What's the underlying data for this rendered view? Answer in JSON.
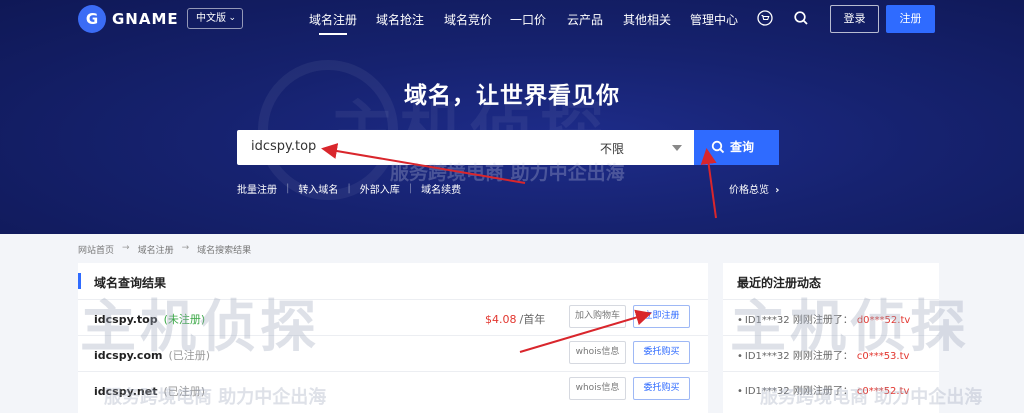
{
  "nav": {
    "logo_letter": "G",
    "logo_text": "GNAME",
    "language": "中文版",
    "items": [
      "域名注册",
      "域名抢注",
      "域名竞价",
      "一口价",
      "云产品",
      "其他相关",
      "管理中心"
    ],
    "login_label": "登录",
    "register_label": "注册"
  },
  "hero": {
    "slogan": "域名，让世界看见你",
    "search_value": "idcspy.top",
    "suffix_selected": "不限",
    "search_button": "查询",
    "quick_links": [
      "批量注册",
      "转入域名",
      "外部入库",
      "域名续费"
    ],
    "price_overview": "价格总览"
  },
  "breadcrumb": [
    "网站首页",
    "域名注册",
    "域名搜索结果"
  ],
  "results": {
    "title": "域名查询结果",
    "rows": [
      {
        "domain": "idcspy.top",
        "status": "(未注册)",
        "price": "$4.08",
        "unit": "/首年",
        "btn1": "加入购物车",
        "btn2": "立即注册"
      },
      {
        "domain": "idcspy.com",
        "status": "(已注册)",
        "btn1": "whois信息",
        "btn2": "委托购买"
      },
      {
        "domain": "idcspy.net",
        "status": "(已注册)",
        "btn1": "whois信息",
        "btn2": "委托购买"
      }
    ]
  },
  "recent": {
    "title": "最近的注册动态",
    "items": [
      {
        "prefix": "ID1***32 刚刚注册了：",
        "domain": "d0***52.tv"
      },
      {
        "prefix": "ID1***32 刚刚注册了：",
        "domain": "c0***53.tv"
      },
      {
        "prefix": "ID1***32 刚刚注册了：",
        "domain": "c0***52.tv"
      }
    ]
  },
  "watermark": {
    "brand": "主机侦探",
    "tagline": "服务跨境电商 助力中企出海"
  },
  "colors": {
    "hero_bg": "#16226f",
    "accent": "#2f6bff",
    "price": "#e2362f",
    "available": "#3aa845",
    "annotation_arrow": "#d9262c"
  }
}
